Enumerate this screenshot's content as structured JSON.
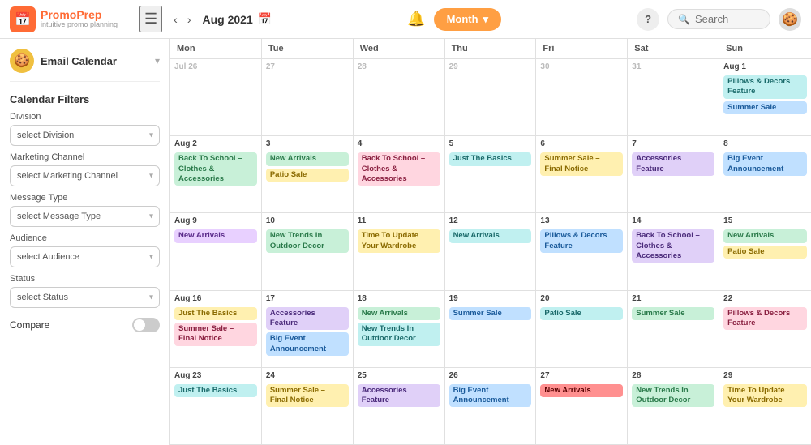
{
  "header": {
    "logo_name": "PromoPrep",
    "logo_sub": "intuitive promo planning",
    "logo_emoji": "📅",
    "menu_icon": "☰",
    "nav_prev": "‹",
    "nav_next": "›",
    "current_date": "Aug 2021",
    "cal_icon": "📅",
    "month_label": "Month",
    "month_chevron": "▾",
    "notif_icon": "🔔",
    "help_label": "?",
    "search_placeholder": "Search",
    "avatar_emoji": "🍪"
  },
  "sidebar": {
    "account_emoji": "🍪",
    "account_name": "Email Calendar",
    "filters_title": "Calendar Filters",
    "division_label": "Division",
    "division_placeholder": "select Division",
    "channel_label": "Marketing Channel",
    "channel_placeholder": "select Marketing Channel",
    "message_label": "Message Type",
    "message_placeholder": "select Message Type",
    "audience_label": "Audience",
    "audience_placeholder": "select Audience",
    "status_label": "Status",
    "status_placeholder": "select Status",
    "compare_label": "Compare"
  },
  "calendar": {
    "day_headers": [
      "Mon",
      "Tue",
      "Wed",
      "Thu",
      "Fri",
      "Sat",
      "Sun"
    ],
    "weeks": [
      [
        {
          "date": "Jul 26",
          "other": true,
          "events": []
        },
        {
          "date": "27",
          "other": true,
          "events": []
        },
        {
          "date": "28",
          "other": true,
          "events": []
        },
        {
          "date": "29",
          "other": true,
          "events": []
        },
        {
          "date": "30",
          "other": true,
          "events": []
        },
        {
          "date": "31",
          "other": true,
          "events": []
        },
        {
          "date": "Aug 1",
          "other": false,
          "events": [
            {
              "label": "Pillows & Decors Feature",
              "color": "ev-teal"
            },
            {
              "label": "Summer Sale",
              "color": "ev-blue"
            }
          ]
        }
      ],
      [
        {
          "date": "Aug 2",
          "other": false,
          "events": [
            {
              "label": "Back To School – Clothes & Accessories",
              "color": "ev-green"
            }
          ]
        },
        {
          "date": "3",
          "other": false,
          "events": [
            {
              "label": "New Arrivals",
              "color": "ev-green"
            },
            {
              "label": "Patio Sale",
              "color": "ev-yellow"
            }
          ]
        },
        {
          "date": "4",
          "other": false,
          "events": [
            {
              "label": "Back To School – Clothes & Accessories",
              "color": "ev-pink"
            }
          ]
        },
        {
          "date": "5",
          "other": false,
          "events": [
            {
              "label": "Just The Basics",
              "color": "ev-teal"
            }
          ]
        },
        {
          "date": "6",
          "other": false,
          "events": [
            {
              "label": "Summer Sale – Final Notice",
              "color": "ev-yellow"
            }
          ]
        },
        {
          "date": "7",
          "other": false,
          "events": [
            {
              "label": "Accessories Feature",
              "color": "ev-lavender"
            }
          ]
        },
        {
          "date": "8",
          "other": false,
          "events": [
            {
              "label": "Big Event Announcement",
              "color": "ev-blue"
            }
          ]
        }
      ],
      [
        {
          "date": "Aug 9",
          "other": false,
          "events": [
            {
              "label": "New Arrivals",
              "color": "ev-purple"
            }
          ]
        },
        {
          "date": "10",
          "other": false,
          "events": [
            {
              "label": "New Trends In Outdoor Decor",
              "color": "ev-green"
            }
          ]
        },
        {
          "date": "11",
          "other": false,
          "events": [
            {
              "label": "Time To Update Your Wardrobe",
              "color": "ev-yellow"
            }
          ]
        },
        {
          "date": "12",
          "other": false,
          "events": [
            {
              "label": "New Arrivals",
              "color": "ev-teal"
            }
          ]
        },
        {
          "date": "13",
          "other": false,
          "events": [
            {
              "label": "Pillows & Decors Feature",
              "color": "ev-blue"
            }
          ]
        },
        {
          "date": "14",
          "other": false,
          "events": [
            {
              "label": "Back To School – Clothes & Accessories",
              "color": "ev-lavender"
            }
          ]
        },
        {
          "date": "15",
          "other": false,
          "events": [
            {
              "label": "New Arrivals",
              "color": "ev-green"
            },
            {
              "label": "Patio Sale",
              "color": "ev-yellow"
            }
          ]
        }
      ],
      [
        {
          "date": "Aug 16",
          "other": false,
          "events": [
            {
              "label": "Just The Basics",
              "color": "ev-yellow"
            },
            {
              "label": "Summer Sale – Final Notice",
              "color": "ev-pink"
            }
          ]
        },
        {
          "date": "17",
          "other": false,
          "events": [
            {
              "label": "Accessories Feature",
              "color": "ev-lavender"
            },
            {
              "label": "Big Event Announcement",
              "color": "ev-blue"
            }
          ]
        },
        {
          "date": "18",
          "other": false,
          "events": [
            {
              "label": "New Arrivals",
              "color": "ev-green"
            },
            {
              "label": "New Trends In Outdoor Decor",
              "color": "ev-teal"
            }
          ]
        },
        {
          "date": "19",
          "other": false,
          "events": [
            {
              "label": "Summer Sale",
              "color": "ev-blue"
            }
          ]
        },
        {
          "date": "20",
          "other": false,
          "events": [
            {
              "label": "Patio Sale",
              "color": "ev-teal"
            }
          ]
        },
        {
          "date": "21",
          "other": false,
          "events": [
            {
              "label": "Summer Sale",
              "color": "ev-green"
            }
          ]
        },
        {
          "date": "22",
          "other": false,
          "events": [
            {
              "label": "Pillows & Decors Feature",
              "color": "ev-pink"
            }
          ]
        }
      ],
      [
        {
          "date": "Aug 23",
          "other": false,
          "events": [
            {
              "label": "Just The Basics",
              "color": "ev-teal"
            }
          ]
        },
        {
          "date": "24",
          "other": false,
          "events": [
            {
              "label": "Summer Sale – Final Notice",
              "color": "ev-yellow"
            }
          ]
        },
        {
          "date": "25",
          "other": false,
          "events": [
            {
              "label": "Accessories Feature",
              "color": "ev-lavender"
            }
          ]
        },
        {
          "date": "26",
          "other": false,
          "events": [
            {
              "label": "Big Event Announcement",
              "color": "ev-blue"
            }
          ]
        },
        {
          "date": "27",
          "other": false,
          "events": [
            {
              "label": "New Arrivals",
              "color": "ev-red"
            }
          ]
        },
        {
          "date": "28",
          "other": false,
          "events": [
            {
              "label": "New Trends In Outdoor Decor",
              "color": "ev-green"
            }
          ]
        },
        {
          "date": "29",
          "other": false,
          "events": [
            {
              "label": "Time To Update Your Wardrobe",
              "color": "ev-yellow"
            }
          ]
        }
      ]
    ]
  }
}
